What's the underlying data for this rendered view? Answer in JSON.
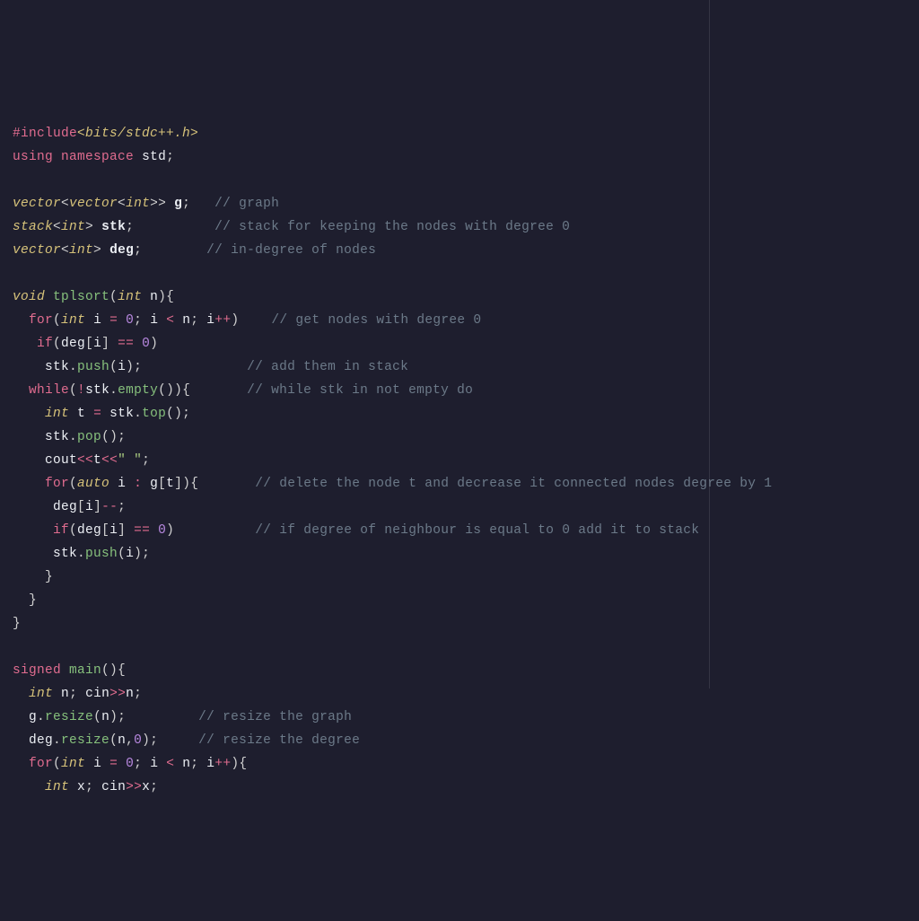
{
  "code": {
    "lines": [
      [
        {
          "c": "tok-pre",
          "t": "#include"
        },
        {
          "c": "tok-inc",
          "t": "<bits/stdc++.h>"
        }
      ],
      [
        {
          "c": "tok-kw",
          "t": "using"
        },
        {
          "c": "",
          "t": " "
        },
        {
          "c": "tok-kw",
          "t": "namespace"
        },
        {
          "c": "",
          "t": " "
        },
        {
          "c": "tok-ns",
          "t": "std"
        },
        {
          "c": "tok-punc",
          "t": ";"
        }
      ],
      [],
      [
        {
          "c": "tok-type",
          "t": "vector"
        },
        {
          "c": "tok-punc",
          "t": "<"
        },
        {
          "c": "tok-type",
          "t": "vector"
        },
        {
          "c": "tok-punc",
          "t": "<"
        },
        {
          "c": "tok-type",
          "t": "int"
        },
        {
          "c": "tok-punc",
          "t": ">>"
        },
        {
          "c": "",
          "t": " "
        },
        {
          "c": "tok-ident",
          "t": "g"
        },
        {
          "c": "tok-punc",
          "t": ";"
        },
        {
          "c": "",
          "t": "   "
        },
        {
          "c": "tok-cmt",
          "t": "// graph"
        }
      ],
      [
        {
          "c": "tok-type",
          "t": "stack"
        },
        {
          "c": "tok-punc",
          "t": "<"
        },
        {
          "c": "tok-type",
          "t": "int"
        },
        {
          "c": "tok-punc",
          "t": ">"
        },
        {
          "c": "",
          "t": " "
        },
        {
          "c": "tok-ident",
          "t": "stk"
        },
        {
          "c": "tok-punc",
          "t": ";"
        },
        {
          "c": "",
          "t": "          "
        },
        {
          "c": "tok-cmt",
          "t": "// stack for keeping the nodes with degree 0"
        }
      ],
      [
        {
          "c": "tok-type",
          "t": "vector"
        },
        {
          "c": "tok-punc",
          "t": "<"
        },
        {
          "c": "tok-type",
          "t": "int"
        },
        {
          "c": "tok-punc",
          "t": ">"
        },
        {
          "c": "",
          "t": " "
        },
        {
          "c": "tok-ident",
          "t": "deg"
        },
        {
          "c": "tok-punc",
          "t": ";"
        },
        {
          "c": "",
          "t": "        "
        },
        {
          "c": "tok-cmt",
          "t": "// in-degree of nodes"
        }
      ],
      [],
      [
        {
          "c": "tok-type",
          "t": "void"
        },
        {
          "c": "",
          "t": " "
        },
        {
          "c": "tok-func",
          "t": "tplsort"
        },
        {
          "c": "tok-punc",
          "t": "("
        },
        {
          "c": "tok-type",
          "t": "int"
        },
        {
          "c": "",
          "t": " "
        },
        {
          "c": "tok-var",
          "t": "n"
        },
        {
          "c": "tok-punc",
          "t": "){"
        }
      ],
      [
        {
          "c": "",
          "t": "  "
        },
        {
          "c": "tok-kw",
          "t": "for"
        },
        {
          "c": "tok-punc",
          "t": "("
        },
        {
          "c": "tok-type",
          "t": "int"
        },
        {
          "c": "",
          "t": " "
        },
        {
          "c": "tok-var",
          "t": "i"
        },
        {
          "c": "",
          "t": " "
        },
        {
          "c": "tok-op",
          "t": "="
        },
        {
          "c": "",
          "t": " "
        },
        {
          "c": "tok-num",
          "t": "0"
        },
        {
          "c": "tok-punc",
          "t": ";"
        },
        {
          "c": "",
          "t": " "
        },
        {
          "c": "tok-var",
          "t": "i"
        },
        {
          "c": "",
          "t": " "
        },
        {
          "c": "tok-op",
          "t": "<"
        },
        {
          "c": "",
          "t": " "
        },
        {
          "c": "tok-var",
          "t": "n"
        },
        {
          "c": "tok-punc",
          "t": ";"
        },
        {
          "c": "",
          "t": " "
        },
        {
          "c": "tok-var",
          "t": "i"
        },
        {
          "c": "tok-op",
          "t": "++"
        },
        {
          "c": "tok-punc",
          "t": ")"
        },
        {
          "c": "",
          "t": "    "
        },
        {
          "c": "tok-cmt",
          "t": "// get nodes with degree 0"
        }
      ],
      [
        {
          "c": "",
          "t": "   "
        },
        {
          "c": "tok-kw",
          "t": "if"
        },
        {
          "c": "tok-punc",
          "t": "("
        },
        {
          "c": "tok-var",
          "t": "deg"
        },
        {
          "c": "tok-punc",
          "t": "["
        },
        {
          "c": "tok-var",
          "t": "i"
        },
        {
          "c": "tok-punc",
          "t": "]"
        },
        {
          "c": "",
          "t": " "
        },
        {
          "c": "tok-op",
          "t": "=="
        },
        {
          "c": "",
          "t": " "
        },
        {
          "c": "tok-num",
          "t": "0"
        },
        {
          "c": "tok-punc",
          "t": ")"
        }
      ],
      [
        {
          "c": "",
          "t": "    "
        },
        {
          "c": "tok-var",
          "t": "stk"
        },
        {
          "c": "tok-punc",
          "t": "."
        },
        {
          "c": "tok-func",
          "t": "push"
        },
        {
          "c": "tok-punc",
          "t": "("
        },
        {
          "c": "tok-var",
          "t": "i"
        },
        {
          "c": "tok-punc",
          "t": ");"
        },
        {
          "c": "",
          "t": "             "
        },
        {
          "c": "tok-cmt",
          "t": "// add them in stack"
        }
      ],
      [
        {
          "c": "",
          "t": "  "
        },
        {
          "c": "tok-kw",
          "t": "while"
        },
        {
          "c": "tok-punc",
          "t": "("
        },
        {
          "c": "tok-op",
          "t": "!"
        },
        {
          "c": "tok-var",
          "t": "stk"
        },
        {
          "c": "tok-punc",
          "t": "."
        },
        {
          "c": "tok-func",
          "t": "empty"
        },
        {
          "c": "tok-punc",
          "t": "()){"
        },
        {
          "c": "",
          "t": "       "
        },
        {
          "c": "tok-cmt",
          "t": "// while stk in not empty do"
        }
      ],
      [
        {
          "c": "",
          "t": "    "
        },
        {
          "c": "tok-type",
          "t": "int"
        },
        {
          "c": "",
          "t": " "
        },
        {
          "c": "tok-var",
          "t": "t"
        },
        {
          "c": "",
          "t": " "
        },
        {
          "c": "tok-op",
          "t": "="
        },
        {
          "c": "",
          "t": " "
        },
        {
          "c": "tok-var",
          "t": "stk"
        },
        {
          "c": "tok-punc",
          "t": "."
        },
        {
          "c": "tok-func",
          "t": "top"
        },
        {
          "c": "tok-punc",
          "t": "();"
        }
      ],
      [
        {
          "c": "",
          "t": "    "
        },
        {
          "c": "tok-var",
          "t": "stk"
        },
        {
          "c": "tok-punc",
          "t": "."
        },
        {
          "c": "tok-func",
          "t": "pop"
        },
        {
          "c": "tok-punc",
          "t": "();"
        }
      ],
      [
        {
          "c": "",
          "t": "    "
        },
        {
          "c": "tok-var",
          "t": "cout"
        },
        {
          "c": "tok-op",
          "t": "<<"
        },
        {
          "c": "tok-var",
          "t": "t"
        },
        {
          "c": "tok-op",
          "t": "<<"
        },
        {
          "c": "tok-str",
          "t": "\" \""
        },
        {
          "c": "tok-punc",
          "t": ";"
        }
      ],
      [
        {
          "c": "",
          "t": "    "
        },
        {
          "c": "tok-kw",
          "t": "for"
        },
        {
          "c": "tok-punc",
          "t": "("
        },
        {
          "c": "tok-type",
          "t": "auto"
        },
        {
          "c": "",
          "t": " "
        },
        {
          "c": "tok-var",
          "t": "i"
        },
        {
          "c": "",
          "t": " "
        },
        {
          "c": "tok-op",
          "t": ":"
        },
        {
          "c": "",
          "t": " "
        },
        {
          "c": "tok-var",
          "t": "g"
        },
        {
          "c": "tok-punc",
          "t": "["
        },
        {
          "c": "tok-var",
          "t": "t"
        },
        {
          "c": "tok-punc",
          "t": "]){"
        },
        {
          "c": "",
          "t": "       "
        },
        {
          "c": "tok-cmt",
          "t": "// delete the node t and decrease it connected nodes degree by 1"
        }
      ],
      [
        {
          "c": "",
          "t": "     "
        },
        {
          "c": "tok-var",
          "t": "deg"
        },
        {
          "c": "tok-punc",
          "t": "["
        },
        {
          "c": "tok-var",
          "t": "i"
        },
        {
          "c": "tok-punc",
          "t": "]"
        },
        {
          "c": "tok-op",
          "t": "--"
        },
        {
          "c": "tok-punc",
          "t": ";"
        }
      ],
      [
        {
          "c": "",
          "t": "     "
        },
        {
          "c": "tok-kw",
          "t": "if"
        },
        {
          "c": "tok-punc",
          "t": "("
        },
        {
          "c": "tok-var",
          "t": "deg"
        },
        {
          "c": "tok-punc",
          "t": "["
        },
        {
          "c": "tok-var",
          "t": "i"
        },
        {
          "c": "tok-punc",
          "t": "]"
        },
        {
          "c": "",
          "t": " "
        },
        {
          "c": "tok-op",
          "t": "=="
        },
        {
          "c": "",
          "t": " "
        },
        {
          "c": "tok-num",
          "t": "0"
        },
        {
          "c": "tok-punc",
          "t": ")"
        },
        {
          "c": "",
          "t": "          "
        },
        {
          "c": "tok-cmt",
          "t": "// if degree of neighbour is equal to 0 add it to stack"
        }
      ],
      [
        {
          "c": "",
          "t": "     "
        },
        {
          "c": "tok-var",
          "t": "stk"
        },
        {
          "c": "tok-punc",
          "t": "."
        },
        {
          "c": "tok-func",
          "t": "push"
        },
        {
          "c": "tok-punc",
          "t": "("
        },
        {
          "c": "tok-var",
          "t": "i"
        },
        {
          "c": "tok-punc",
          "t": ");"
        }
      ],
      [
        {
          "c": "",
          "t": "    "
        },
        {
          "c": "tok-punc",
          "t": "}"
        }
      ],
      [
        {
          "c": "",
          "t": "  "
        },
        {
          "c": "tok-punc",
          "t": "}"
        }
      ],
      [
        {
          "c": "tok-punc",
          "t": "}"
        }
      ],
      [],
      [
        {
          "c": "tok-kw",
          "t": "signed"
        },
        {
          "c": "",
          "t": " "
        },
        {
          "c": "tok-func",
          "t": "main"
        },
        {
          "c": "tok-punc",
          "t": "(){"
        }
      ],
      [
        {
          "c": "",
          "t": "  "
        },
        {
          "c": "tok-type",
          "t": "int"
        },
        {
          "c": "",
          "t": " "
        },
        {
          "c": "tok-var",
          "t": "n"
        },
        {
          "c": "tok-punc",
          "t": ";"
        },
        {
          "c": "",
          "t": " "
        },
        {
          "c": "tok-var",
          "t": "cin"
        },
        {
          "c": "tok-op",
          "t": ">>"
        },
        {
          "c": "tok-var",
          "t": "n"
        },
        {
          "c": "tok-punc",
          "t": ";"
        }
      ],
      [
        {
          "c": "",
          "t": "  "
        },
        {
          "c": "tok-var",
          "t": "g"
        },
        {
          "c": "tok-punc",
          "t": "."
        },
        {
          "c": "tok-func",
          "t": "resize"
        },
        {
          "c": "tok-punc",
          "t": "("
        },
        {
          "c": "tok-var",
          "t": "n"
        },
        {
          "c": "tok-punc",
          "t": ");"
        },
        {
          "c": "",
          "t": "         "
        },
        {
          "c": "tok-cmt",
          "t": "// resize the graph"
        }
      ],
      [
        {
          "c": "",
          "t": "  "
        },
        {
          "c": "tok-var",
          "t": "deg"
        },
        {
          "c": "tok-punc",
          "t": "."
        },
        {
          "c": "tok-func",
          "t": "resize"
        },
        {
          "c": "tok-punc",
          "t": "("
        },
        {
          "c": "tok-var",
          "t": "n"
        },
        {
          "c": "tok-punc",
          "t": ","
        },
        {
          "c": "tok-num",
          "t": "0"
        },
        {
          "c": "tok-punc",
          "t": ");"
        },
        {
          "c": "",
          "t": "     "
        },
        {
          "c": "tok-cmt",
          "t": "// resize the degree"
        }
      ],
      [
        {
          "c": "",
          "t": "  "
        },
        {
          "c": "tok-kw",
          "t": "for"
        },
        {
          "c": "tok-punc",
          "t": "("
        },
        {
          "c": "tok-type",
          "t": "int"
        },
        {
          "c": "",
          "t": " "
        },
        {
          "c": "tok-var",
          "t": "i"
        },
        {
          "c": "",
          "t": " "
        },
        {
          "c": "tok-op",
          "t": "="
        },
        {
          "c": "",
          "t": " "
        },
        {
          "c": "tok-num",
          "t": "0"
        },
        {
          "c": "tok-punc",
          "t": ";"
        },
        {
          "c": "",
          "t": " "
        },
        {
          "c": "tok-var",
          "t": "i"
        },
        {
          "c": "",
          "t": " "
        },
        {
          "c": "tok-op",
          "t": "<"
        },
        {
          "c": "",
          "t": " "
        },
        {
          "c": "tok-var",
          "t": "n"
        },
        {
          "c": "tok-punc",
          "t": ";"
        },
        {
          "c": "",
          "t": " "
        },
        {
          "c": "tok-var",
          "t": "i"
        },
        {
          "c": "tok-op",
          "t": "++"
        },
        {
          "c": "tok-punc",
          "t": "){"
        }
      ],
      [
        {
          "c": "",
          "t": "    "
        },
        {
          "c": "tok-type",
          "t": "int"
        },
        {
          "c": "",
          "t": " "
        },
        {
          "c": "tok-var",
          "t": "x"
        },
        {
          "c": "tok-punc",
          "t": ";"
        },
        {
          "c": "",
          "t": " "
        },
        {
          "c": "tok-var",
          "t": "cin"
        },
        {
          "c": "tok-op",
          "t": ">>"
        },
        {
          "c": "tok-var",
          "t": "x"
        },
        {
          "c": "tok-punc",
          "t": ";"
        }
      ]
    ]
  }
}
